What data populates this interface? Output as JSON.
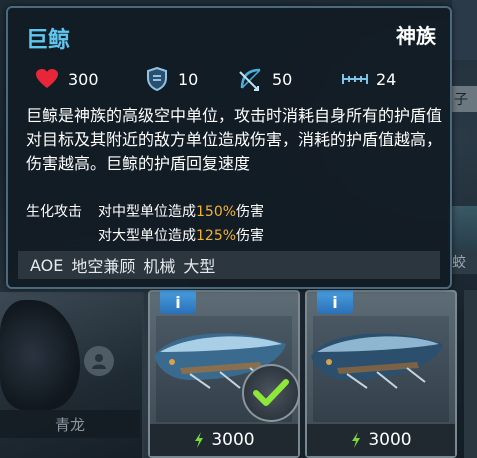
{
  "tooltip": {
    "unit_name": "巨鲸",
    "faction": "神族",
    "stats": {
      "health": "300",
      "armor": "10",
      "attack": "50",
      "range": "24"
    },
    "description": "巨鲸是神族的高级空中单位，攻击时消耗自身所有的护盾值对目标及其附近的敌方单位造成伤害，消耗的护盾值越高，伤害越高。巨鲸的护盾回复速度",
    "attack": {
      "label": "生化攻击",
      "rows": [
        {
          "prefix": "对中型单位造成",
          "pct": "150%",
          "suffix": "伤害"
        },
        {
          "prefix": "对大型单位造成",
          "pct": "125%",
          "suffix": "伤害"
        }
      ]
    },
    "tags": [
      "AOE",
      "地空兼顾",
      "机械",
      "大型"
    ]
  },
  "cards": [
    {
      "cost": "3000",
      "selected": true,
      "info_label": "i"
    },
    {
      "cost": "3000",
      "selected": false,
      "info_label": "i"
    }
  ],
  "background": {
    "left_unit_name": "青龙",
    "right_label_1": "子",
    "right_label_2": "蛟"
  },
  "colors": {
    "title": "#5ec8f0",
    "highlight": "#f2b234",
    "check": "#8ee83a",
    "cost_icon": "#7ad83a"
  }
}
